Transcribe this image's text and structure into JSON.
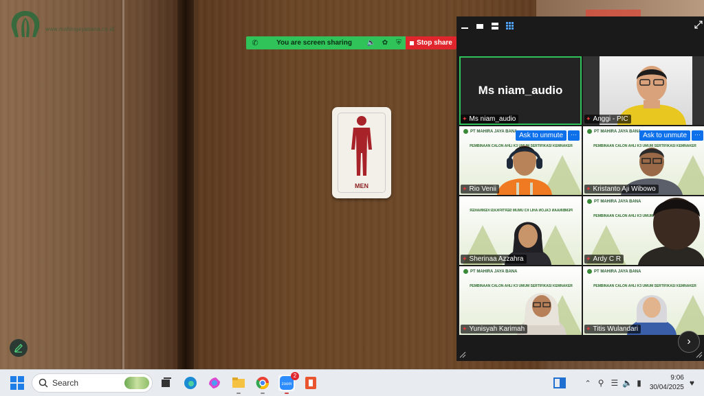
{
  "background": {
    "logo_text": "www.mahirajayabana.co.id",
    "door_sign_label": "MEN"
  },
  "share_bar": {
    "status_text": "You are screen sharing",
    "stop_label": "Stop share"
  },
  "zoom": {
    "participants": [
      {
        "name": "Ms niam_audio",
        "big_label": "Ms niam_audio",
        "muted": true,
        "active_speaker": true
      },
      {
        "name": "Anggi - PIC",
        "muted": true
      },
      {
        "name": "Rio Venii",
        "muted": true,
        "ask_to_unmute": "Ask to unmute"
      },
      {
        "name": "Kristanto Aji Wibowo",
        "muted": true,
        "ask_to_unmute": "Ask to unmute"
      },
      {
        "name": "Sherinaa Azzahra",
        "muted": true
      },
      {
        "name": "Ardy C R",
        "muted": true
      },
      {
        "name": "Yunisyah Karimah",
        "muted": true
      },
      {
        "name": "Titis Wulandari",
        "muted": true
      }
    ],
    "slide_header": "PT MAHIRA JAYA BANA",
    "slide_subtitle": "PEMBINAAN CALON AHLI K3 UMUM SERTIFIKASI KEMNAKER",
    "more_label": "···"
  },
  "taskbar": {
    "search_placeholder": "Search",
    "zoom_badge": "2",
    "time": "9:06",
    "date": "30/04/2025"
  },
  "colors": {
    "zoom_blue": "#0e71eb",
    "share_green": "#2fc35a",
    "stop_red": "#e0262c",
    "active_speaker_border": "#2fc35a"
  }
}
